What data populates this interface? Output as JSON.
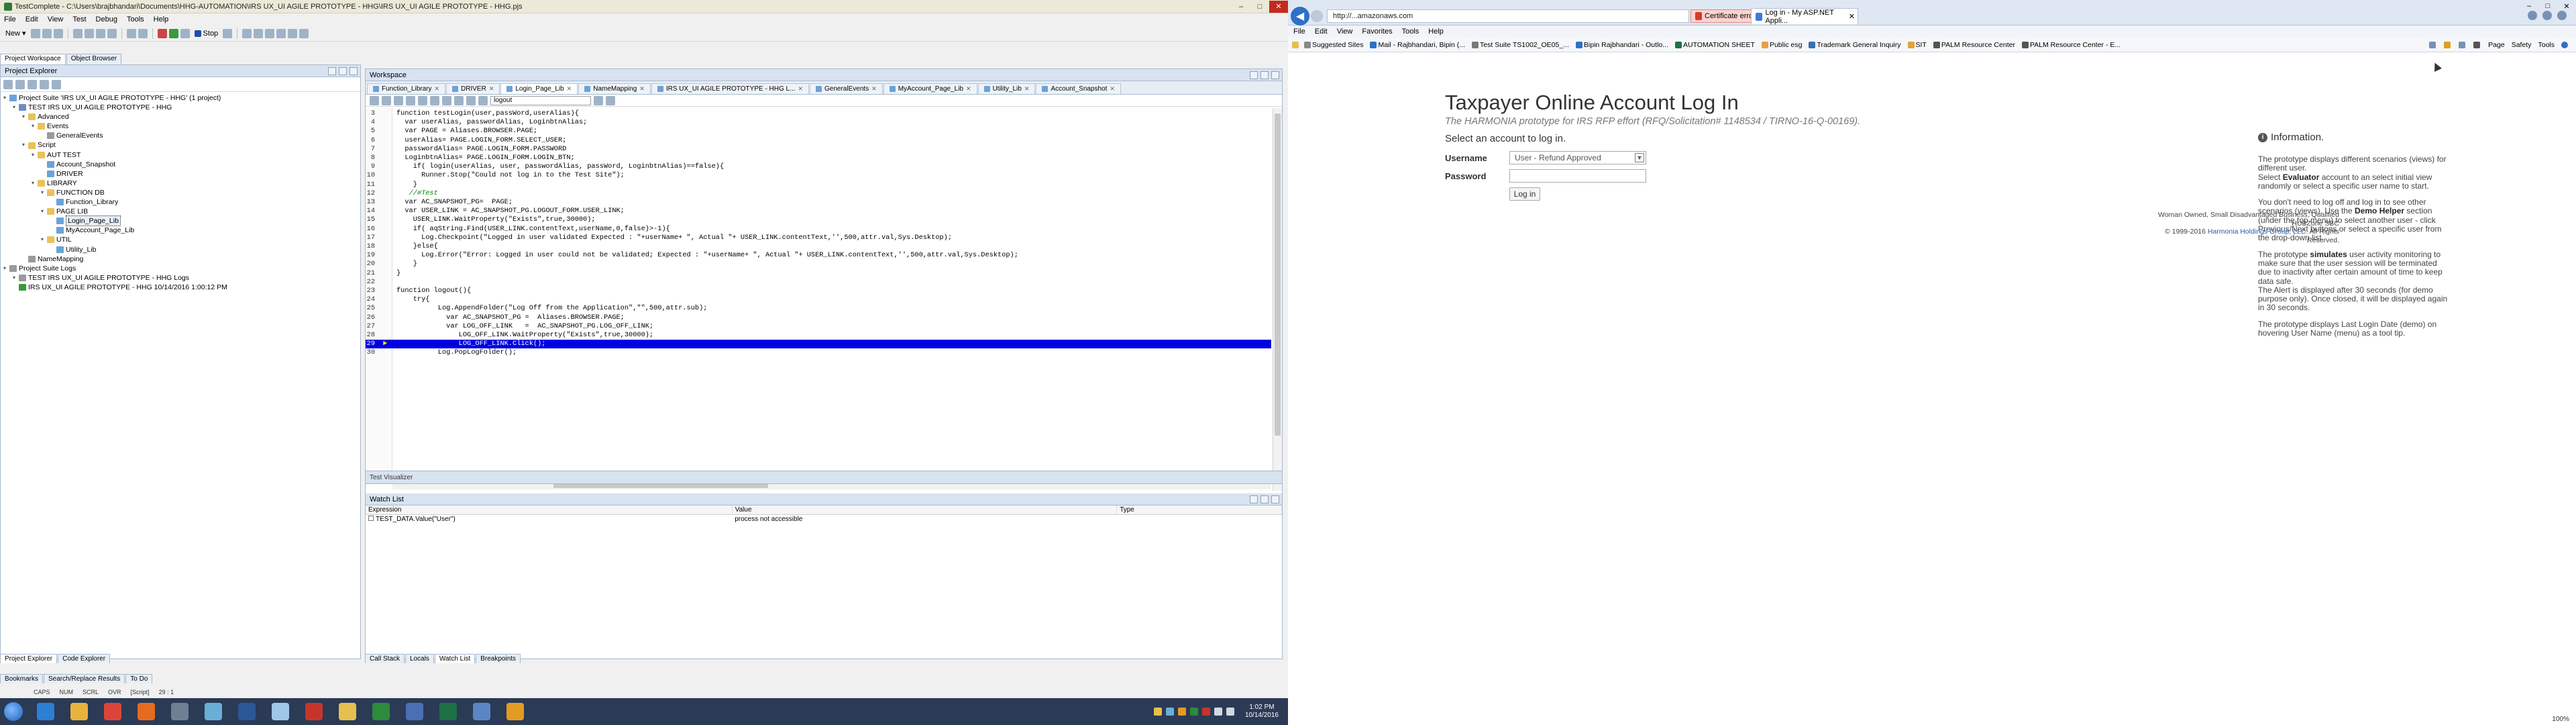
{
  "tc": {
    "title": "TestComplete - C:\\Users\\brajbhandari\\Documents\\HHG-AUTOMATION\\IRS UX_UI AGILE PROTOTYPE - HHG\\IRS UX_UI AGILE PROTOTYPE - HHG.pjs",
    "menu": [
      "File",
      "Edit",
      "View",
      "Test",
      "Debug",
      "Tools",
      "Help"
    ],
    "toolbar": {
      "new_label": "New",
      "stop_label": "Stop"
    },
    "panel_tabs": [
      "Project Workspace",
      "Object Browser"
    ],
    "project_explorer": {
      "title": "Project Explorer",
      "tree": [
        {
          "label": "Project Suite 'IRS UX_UI AGILE PROTOTYPE - HHG' (1 project)",
          "level": 0,
          "icon": "suite"
        },
        {
          "label": "TEST IRS UX_UI AGILE PROTOTYPE - HHG",
          "level": 1,
          "icon": "project"
        },
        {
          "label": "Advanced",
          "level": 2,
          "icon": "folder"
        },
        {
          "label": "Events",
          "level": 3,
          "icon": "folder"
        },
        {
          "label": "GeneralEvents",
          "level": 4,
          "icon": "item"
        },
        {
          "label": "Script",
          "level": 2,
          "icon": "folder"
        },
        {
          "label": "AUT TEST",
          "level": 3,
          "icon": "folder"
        },
        {
          "label": "Account_Snapshot",
          "level": 4,
          "icon": "script"
        },
        {
          "label": "DRIVER",
          "level": 4,
          "icon": "script"
        },
        {
          "label": "LIBRARY",
          "level": 3,
          "icon": "folder"
        },
        {
          "label": "FUNCTION DB",
          "level": 4,
          "icon": "folder"
        },
        {
          "label": "Function_Library",
          "level": 5,
          "icon": "script"
        },
        {
          "label": "PAGE LIB",
          "level": 4,
          "icon": "folder"
        },
        {
          "label": "Login_Page_Lib",
          "level": 5,
          "icon": "script",
          "selected": true
        },
        {
          "label": "MyAccount_Page_Lib",
          "level": 5,
          "icon": "script"
        },
        {
          "label": "UTIL",
          "level": 4,
          "icon": "folder"
        },
        {
          "label": "Utility_Lib",
          "level": 5,
          "icon": "script"
        },
        {
          "label": "NameMapping",
          "level": 2,
          "icon": "item"
        },
        {
          "label": "Project Suite Logs",
          "level": 0,
          "icon": "logs"
        },
        {
          "label": "TEST IRS UX_UI AGILE PROTOTYPE - HHG Logs",
          "level": 1,
          "icon": "logs"
        },
        {
          "label": "IRS UX_UI AGILE PROTOTYPE - HHG 10/14/2016 1:00:12 PM",
          "level": 1,
          "icon": "ok"
        }
      ],
      "bottom_tabs": [
        "Project Explorer",
        "Code Explorer"
      ]
    },
    "workspace": {
      "title": "Workspace",
      "tabs": [
        "Function_Library",
        "DRIVER",
        "Login_Page_Lib",
        "NameMapping",
        "IRS UX_UI AGILE PROTOTYPE - HHG L...",
        "GeneralEvents",
        "MyAccount_Page_Lib",
        "Utility_Lib",
        "Account_Snapshot"
      ],
      "active_tab": "Login_Page_Lib",
      "routine": "logout"
    },
    "code_lines": [
      {
        "n": "3",
        "t": "function testLogin(user,passWord,userAlias){"
      },
      {
        "n": "4",
        "t": "  var userAlias, passwordAlias, LoginbtnAlias;"
      },
      {
        "n": "5",
        "t": "  var PAGE = Aliases.BROWSER.PAGE;"
      },
      {
        "n": "6",
        "t": "  userAlias= PAGE.LOGIN_FORM.SELECT_USER;"
      },
      {
        "n": "7",
        "t": "  passwordAlias= PAGE.LOGIN_FORM.PASSWORD"
      },
      {
        "n": "8",
        "t": "  LoginbtnAlias= PAGE.LOGIN_FORM.LOGIN_BTN;"
      },
      {
        "n": "9",
        "t": "    if( login(userAlias, user, passwordAlias, passWord, LoginbtnAlias)==false){"
      },
      {
        "n": "10",
        "t": "      Runner.Stop(\"Could not log in to the Test Site\");"
      },
      {
        "n": "11",
        "t": "    }"
      },
      {
        "n": "12",
        "t": "   //#Test"
      },
      {
        "n": "13",
        "t": "  var AC_SNAPSHOT_PG=  PAGE;"
      },
      {
        "n": "14",
        "t": "  var USER_LINK = AC_SNAPSHOT_PG.LOGOUT_FORM.USER_LINK;"
      },
      {
        "n": "15",
        "t": "    USER_LINK.WaitProperty(\"Exists\",true,30000);"
      },
      {
        "n": "16",
        "t": "    if( aqString.Find(USER_LINK.contentText,userName,0,false)>-1){"
      },
      {
        "n": "17",
        "t": "      Log.Checkpoint(\"Logged in user validated Expected : \"+userName+ \", Actual \"+ USER_LINK.contentText,'',500,attr.val,Sys.Desktop);"
      },
      {
        "n": "18",
        "t": "    }else{"
      },
      {
        "n": "19",
        "t": "      Log.Error(\"Error: Logged in user could not be validated; Expected : \"+userName+ \", Actual \"+ USER_LINK.contentText,'',500,attr.val,Sys.Desktop);"
      },
      {
        "n": "20",
        "t": "    }"
      },
      {
        "n": "21",
        "t": "}"
      },
      {
        "n": "22",
        "t": ""
      },
      {
        "n": "23",
        "t": "function logout(){"
      },
      {
        "n": "24",
        "t": "    try{"
      },
      {
        "n": "25",
        "t": "          Log.AppendFolder(\"Log Off from the Application\",\"\",500,attr.sub);"
      },
      {
        "n": "26",
        "t": "            var AC_SNAPSHOT_PG =  Aliases.BROWSER.PAGE;"
      },
      {
        "n": "27",
        "t": "            var LOG_OFF_LINK   =  AC_SNAPSHOT_PG.LOG_OFF_LINK;"
      },
      {
        "n": "28",
        "t": "               LOG_OFF_LINK.WaitProperty(\"Exists\",true,30000);"
      },
      {
        "n": "29",
        "t": "               LOG_OFF_LINK.Click();"
      },
      {
        "n": "30",
        "t": "          Log.PopLogFolder();"
      }
    ],
    "highlight_line": "29",
    "test_visualizer": "Test Visualizer",
    "watch_list": {
      "title": "Watch List",
      "columns": [
        "Expression",
        "Value",
        "Type"
      ],
      "rows": [
        {
          "expression": "TEST_DATA.Value(\"User\")",
          "value": "process not accessible",
          "type": ""
        }
      ]
    },
    "ws_bottom_tabs": [
      "Call Stack",
      "Locals",
      "Watch List",
      "Breakpoints"
    ],
    "pe_lower_tabs": [
      "Bookmarks",
      "Search/Replace Results",
      "To Do"
    ],
    "status": [
      "CAPS",
      "NUM",
      "SCRL",
      "OVR",
      "[Script]",
      "29 : 1"
    ]
  },
  "taskbar": {
    "apps": [
      {
        "name": "ie-app",
        "color": "#2c7fd3"
      },
      {
        "name": "explorer-app",
        "color": "#e9b23c"
      },
      {
        "name": "chrome-app",
        "color": "#dc4437"
      },
      {
        "name": "firefox-app",
        "color": "#e56b1f"
      },
      {
        "name": "calculator-app",
        "color": "#6f7f94"
      },
      {
        "name": "monitor-app",
        "color": "#6aaed6"
      },
      {
        "name": "word-app",
        "color": "#2b5797"
      },
      {
        "name": "notepad-app",
        "color": "#9fc7e8"
      },
      {
        "name": "pdf-app",
        "color": "#c7352a"
      },
      {
        "name": "folder-app",
        "color": "#e6c04e"
      },
      {
        "name": "testcomplete-app",
        "color": "#2e8a3c"
      },
      {
        "name": "tool-app",
        "color": "#4a6fb5"
      },
      {
        "name": "excel-app",
        "color": "#1e7145"
      },
      {
        "name": "network-app",
        "color": "#5b86c4"
      },
      {
        "name": "outlook-app",
        "color": "#e39b22"
      }
    ],
    "time": "1:02 PM",
    "date": "10/14/2016"
  },
  "ie": {
    "address": "http://...amazonaws.com",
    "cert_error": "Certificate error",
    "tab_title": "Log in - My ASP.NET Appli...",
    "menu": [
      "File",
      "Edit",
      "View",
      "Favorites",
      "Tools",
      "Help"
    ],
    "favorites": [
      {
        "label": "Suggested Sites",
        "color": "#888888"
      },
      {
        "label": "Mail - Rajbhandari, Bipin (...",
        "color": "#2b72c9"
      },
      {
        "label": "Test Suite TS1002_OE05_...",
        "color": "#7a7a7a"
      },
      {
        "label": "Bipin Rajbhandari - Outlo...",
        "color": "#2b72c9"
      },
      {
        "label": "AUTOMATION SHEET",
        "color": "#1e7145"
      },
      {
        "label": "Public esg",
        "color": "#e6a23c"
      },
      {
        "label": "Trademark General Inquiry",
        "color": "#3a6fb5"
      },
      {
        "label": "SIT",
        "color": "#e6a23c"
      },
      {
        "label": "PALM Resource Center",
        "color": "#555555"
      },
      {
        "label": "PALM Resource Center - E...",
        "color": "#555555"
      }
    ],
    "command": [
      "Page",
      "Safety",
      "Tools"
    ],
    "zoom": "100%"
  },
  "login_page": {
    "title": "Taxpayer Online Account Log In",
    "subtitle": "The HARMONIA prototype for IRS RFP effort (RFQ/Solicitation# 1148534 / TIRNO-16-Q-00169).",
    "select_prompt": "Select an account to log in.",
    "username_label": "Username",
    "username_value": "User - Refund Approved",
    "password_label": "Password",
    "login_button": "Log in",
    "info_title": "Information.",
    "info_p1": "The prototype displays different scenarios (views) for different user.",
    "info_p1b_pre": "Select ",
    "info_p1b_bold": "Evaluator",
    "info_p1b_post": " account to an select initial view randomly or select a specific user name to start.",
    "info_p2_pre": "You don't need to log off and log in to see other scenarios (views). Use the ",
    "info_p2_bold": "Demo Helper",
    "info_p2_post": " section (under the top menu) to select another user - click Previous/Next buttons or select a specific user from the drop-down list.",
    "info_p3_pre": "The prototype ",
    "info_p3_bold": "simulates",
    "info_p3_post": " user activity monitoring to make sure that the user session will be terminated due to inactivity after certain amount of time to keep data safe.",
    "info_p4": "The Alert is displayed after 30 seconds (for demo purpose only). Once closed, it will be displayed again in 30 seconds.",
    "info_p5": "The prototype displays Last Login Date (demo) on hovering User Name (menu) as a tool tip.",
    "footer1": "Woman Owned, Small Disadvantaged Business, Qualified HUBZone SBC",
    "footer2_pre": "© 1999-2016 ",
    "footer2_link": "Harmonia Holdings Group, LLC",
    "footer2_post": ". All Rights Reserved."
  }
}
